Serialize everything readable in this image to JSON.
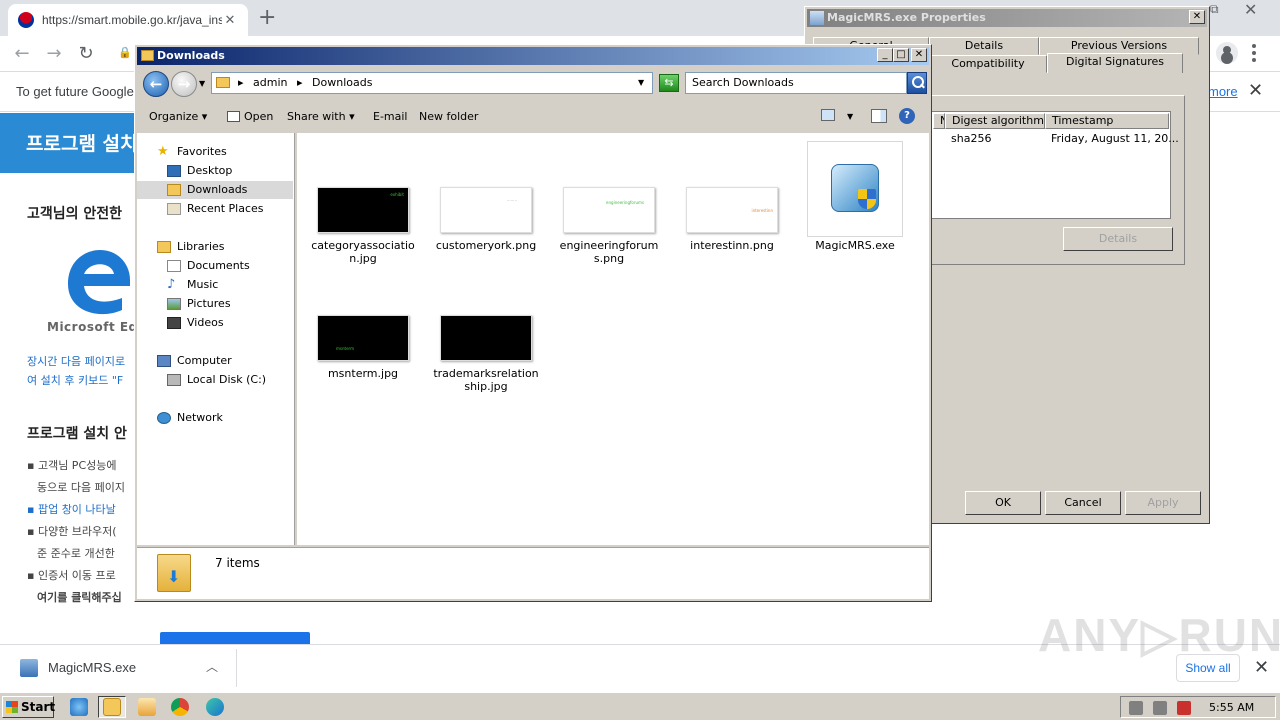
{
  "browser": {
    "tab_title": "https://smart.mobile.go.kr/java_inst",
    "tab_close": "✕",
    "new_tab": "+",
    "infobar_message": "To get future Google",
    "infobar_link": "more",
    "infobar_close": "✕"
  },
  "webpage": {
    "banner": "프로그램 설치",
    "heading1": "고객님의 안전한",
    "edge_name": "Microsoft Edge",
    "link_line1": "장시간 다음 페이지로",
    "link_line2": "여 설치 후 키보드 \"F",
    "heading2": "프로그램 설치 안",
    "bullets": [
      "▪ 고객님 PC성능에",
      "동으로 다음 페이지",
      "▪ 팝업 창이 나타날",
      "▪ 다양한 브라우저(",
      "준 준수로 개선한",
      "▪ 인증서 이동 프로",
      "여기를 클릭해주십"
    ]
  },
  "download_bar": {
    "file_name": "MagicMRS.exe",
    "show_all": "Show all",
    "close": "✕"
  },
  "watermark": "ANY▷RUN",
  "taskbar": {
    "start": "Start",
    "clock": "5:55 AM"
  },
  "properties": {
    "title": "MagicMRS.exe Properties",
    "close": "✕",
    "tabs_row1": [
      "General",
      "Details",
      "Previous Versions"
    ],
    "tabs_row2": [
      "Compatibility",
      "Digital Signatures"
    ],
    "selected_tab": "Digital Signatures",
    "columns": [
      "Name of signer",
      "Digest algorithm",
      "Timestamp"
    ],
    "rows": [
      {
        "signer": "",
        "digest": "sha256",
        "timestamp": "Friday, August 11, 20..."
      }
    ],
    "details_button": "Details",
    "ok": "OK",
    "cancel": "Cancel",
    "apply": "Apply"
  },
  "explorer": {
    "title": "Downloads",
    "minimize": "_",
    "maximize": "□",
    "close": "✕",
    "breadcrumb": [
      "admin",
      "Downloads"
    ],
    "search_placeholder": "Search Downloads",
    "commands": {
      "organize": "Organize",
      "open": "Open",
      "share_with": "Share with",
      "email": "E-mail",
      "new_folder": "New folder",
      "help": "?"
    },
    "nav": {
      "favorites": "Favorites",
      "desktop": "Desktop",
      "downloads": "Downloads",
      "recent_places": "Recent Places",
      "libraries": "Libraries",
      "documents": "Documents",
      "music": "Music",
      "pictures": "Pictures",
      "videos": "Videos",
      "computer": "Computer",
      "local_disk": "Local Disk (C:)",
      "network": "Network"
    },
    "files": [
      {
        "name": "categoryassociation.jpg",
        "thumb": "dark",
        "thumb_text": "exhibit",
        "thumb_color": "#3fbf3f"
      },
      {
        "name": "customeryork.png",
        "thumb": "light",
        "thumb_text": "········",
        "thumb_color": "#aaaaaa"
      },
      {
        "name": "engineeringforums.png",
        "thumb": "light",
        "thumb_text": "engineeringforums",
        "thumb_color": "#3fbf3f"
      },
      {
        "name": "interestinn.png",
        "thumb": "light",
        "thumb_text": "interestinn",
        "thumb_color": "#e08a3a"
      },
      {
        "name": "MagicMRS.exe",
        "thumb": "exe"
      },
      {
        "name": "msnterm.jpg",
        "thumb": "dark",
        "thumb_text": "msnterm",
        "thumb_color": "#3fbf3f"
      },
      {
        "name": "trademarksrelationship.jpg",
        "thumb": "dark",
        "thumb_text": "",
        "thumb_color": "#3fbf3f"
      }
    ],
    "item_count": "7 items"
  }
}
